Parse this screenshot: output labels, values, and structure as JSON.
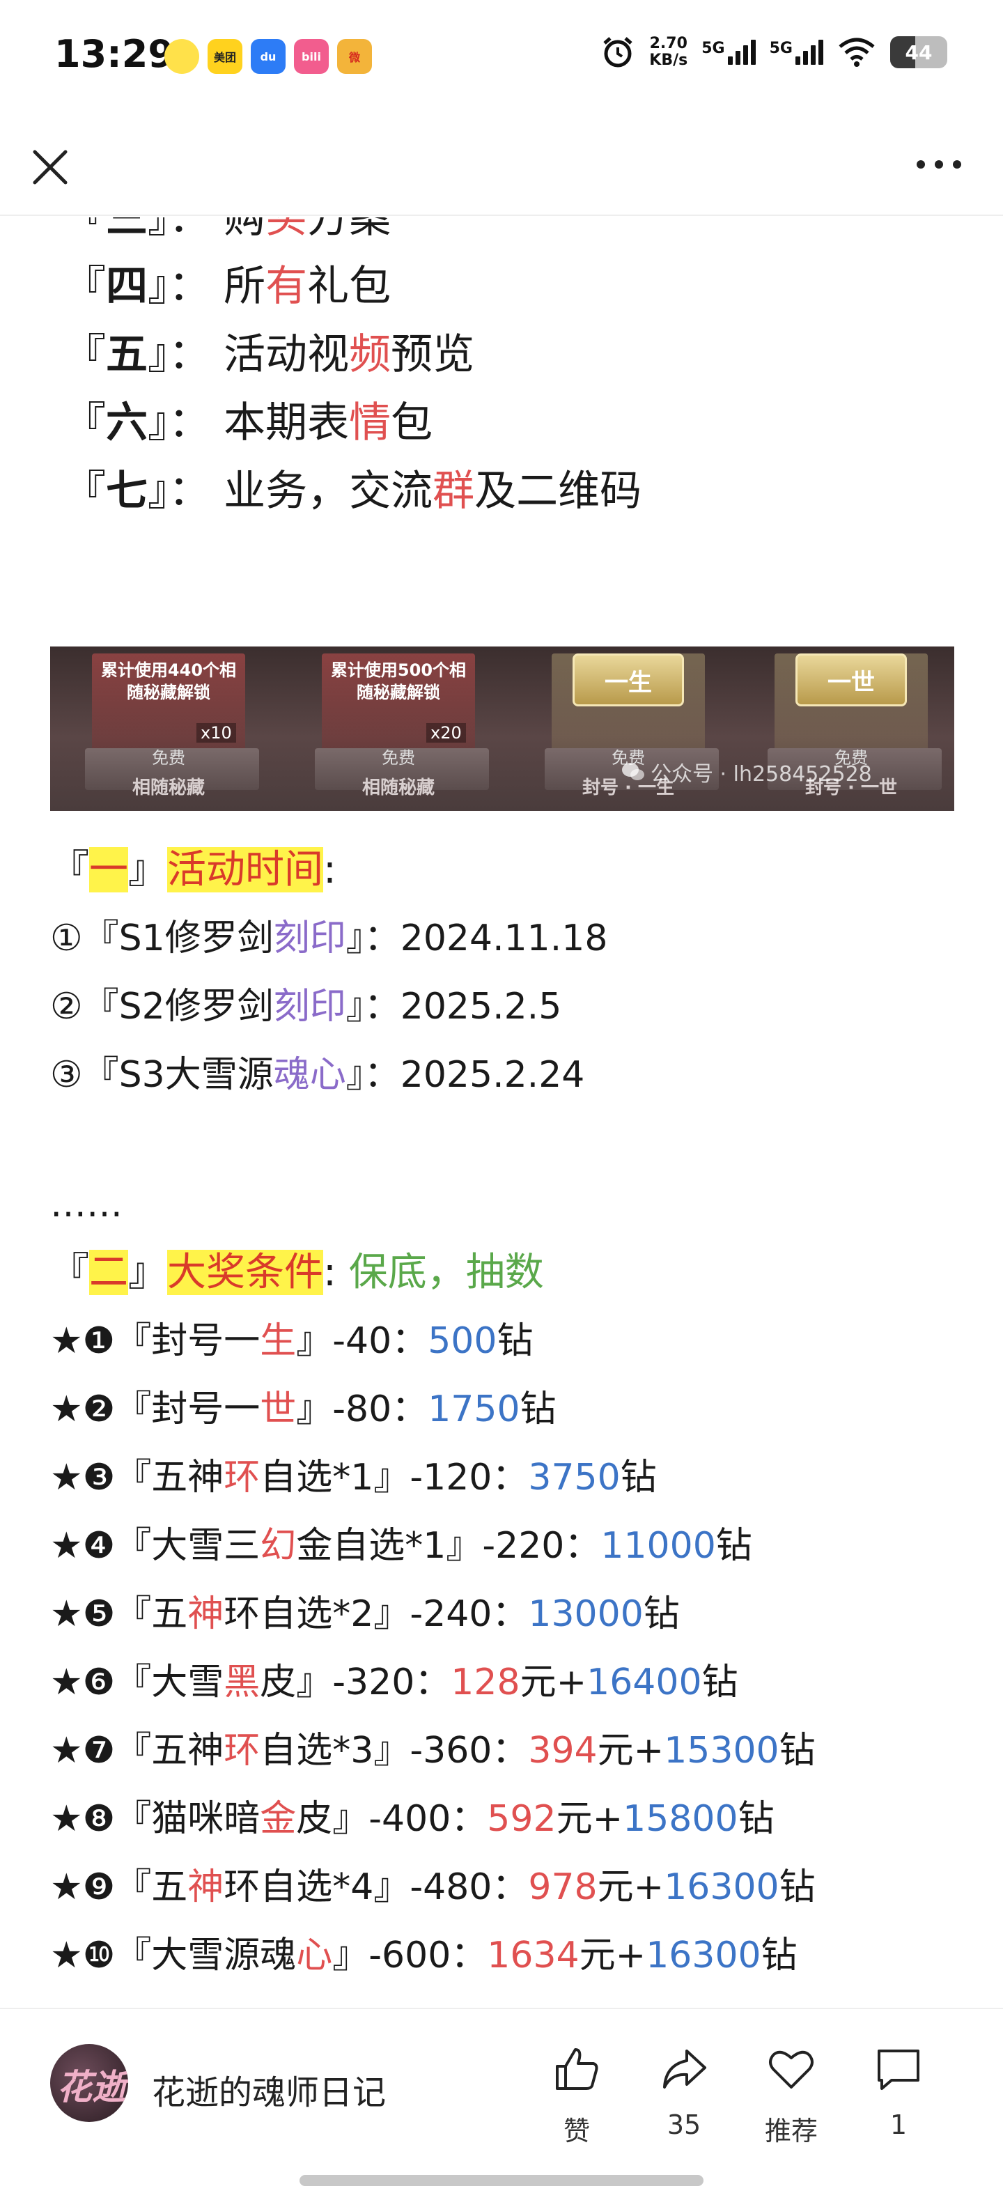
{
  "status_bar": {
    "time": "13:29",
    "apps": [
      {
        "name": "qq-music-icon",
        "label": "",
        "color": "#ffe14a"
      },
      {
        "name": "meituan-icon",
        "label": "美团",
        "color": "#ffd21e"
      },
      {
        "name": "dewu-icon",
        "label": "du",
        "color": "#2d7cf6"
      },
      {
        "name": "bilibili-icon",
        "label": "bili",
        "color": "#f25d8e"
      },
      {
        "name": "weibo-icon",
        "label": "微",
        "color": "#f3b43a"
      }
    ],
    "speed_value": "2.70",
    "speed_unit": "KB/s",
    "net1": "5G",
    "net2": "5G",
    "battery": "44",
    "battery_level": 0.44
  },
  "nav": {
    "close_icon": "close-icon",
    "more_icon": "more-icon"
  },
  "toc": {
    "items": [
      {
        "num": "三",
        "pre": "购",
        "hl": "买",
        "post": "方案"
      },
      {
        "num": "四",
        "pre": "所",
        "hl": "有",
        "post": "礼包"
      },
      {
        "num": "五",
        "pre": "活动视",
        "hl": "频",
        "post": "预览"
      },
      {
        "num": "六",
        "pre": "本期表",
        "hl": "情",
        "post": "包"
      },
      {
        "num": "七",
        "pre": "业务，交流",
        "hl": "群",
        "post": "及二维码"
      }
    ]
  },
  "banner": {
    "box1_text": "累计使用440个相随秘藏解锁",
    "box1_count": "x10",
    "box1_free": "免费",
    "box1_label": "相随秘藏",
    "box2_text": "累计使用500个相随秘藏解锁",
    "box2_count": "x20",
    "box2_free": "免费",
    "box2_label": "相随秘藏",
    "box3_plate": "一生",
    "box3_free": "免费",
    "box3_label": "封号 · 一生",
    "box4_plate": "一世",
    "box4_free": "免费",
    "box4_label": "封号 · 一世",
    "watermark": "公众号 · lh258452528"
  },
  "section1": {
    "open": "『",
    "num": "一",
    "close": "』",
    "title": "活动时间",
    "colon": ":",
    "items": [
      {
        "prefix": "①『S1修罗剑",
        "hl": "刻印",
        "suffix": "』：2024.11.18"
      },
      {
        "prefix": "②『S2修罗剑",
        "hl": "刻印",
        "suffix": "』：2025.2.5"
      },
      {
        "prefix": "③『S3大雪源",
        "hl": "魂心",
        "suffix": "』：2025.2.24"
      }
    ],
    "ellipsis": "……"
  },
  "section2": {
    "open": "『",
    "num": "二",
    "close": "』",
    "title": "大奖条件",
    "colon": ":",
    "note": "保底，抽数",
    "items": [
      {
        "pre": "★❶『封号一",
        "hl": "生",
        "mid": "』-40：",
        "rmb": "",
        "rmb_unit": "",
        "diamond": "500",
        "unit": "钻"
      },
      {
        "pre": "★❷『封号一",
        "hl": "世",
        "mid": "』-80：",
        "rmb": "",
        "rmb_unit": "",
        "diamond": "1750",
        "unit": "钻"
      },
      {
        "pre": "★❸『五神",
        "hl": "环",
        "mid": "自选*1』-120：",
        "rmb": "",
        "rmb_unit": "",
        "diamond": "3750",
        "unit": "钻"
      },
      {
        "pre": "★❹『大雪三",
        "hl": "幻",
        "mid": "金自选*1』-220：",
        "rmb": "",
        "rmb_unit": "",
        "diamond": "11000",
        "unit": "钻"
      },
      {
        "pre": "★❺『五",
        "hl": "神",
        "mid": "环自选*2』-240：",
        "rmb": "",
        "rmb_unit": "",
        "diamond": "13000",
        "unit": "钻"
      },
      {
        "pre": "★❻『大雪",
        "hl": "黑",
        "mid": "皮』-320：",
        "rmb": "128",
        "rmb_unit": "元+",
        "diamond": "16400",
        "unit": "钻"
      },
      {
        "pre": "★❼『五神",
        "hl": "环",
        "mid": "自选*3』-360：",
        "rmb": "394",
        "rmb_unit": "元+",
        "diamond": "15300",
        "unit": "钻"
      },
      {
        "pre": "★❽『猫咪暗",
        "hl": "金",
        "mid": "皮』-400：",
        "rmb": "592",
        "rmb_unit": "元+",
        "diamond": "15800",
        "unit": "钻"
      },
      {
        "pre": "★❾『五",
        "hl": "神",
        "mid": "环自选*4』-480：",
        "rmb": "978",
        "rmb_unit": "元+",
        "diamond": "16300",
        "unit": "钻"
      },
      {
        "pre": "★❿『大雪源魂",
        "hl": "心",
        "mid": "』-600：",
        "rmb": "1634",
        "rmb_unit": "元+",
        "diamond": "16300",
        "unit": "钻"
      }
    ]
  },
  "bottom": {
    "avatar_text": "花逝",
    "author": "花逝的魂师日记",
    "like_label": "赞",
    "share_count": "35",
    "recommend_label": "推荐",
    "comment_count": "1"
  }
}
